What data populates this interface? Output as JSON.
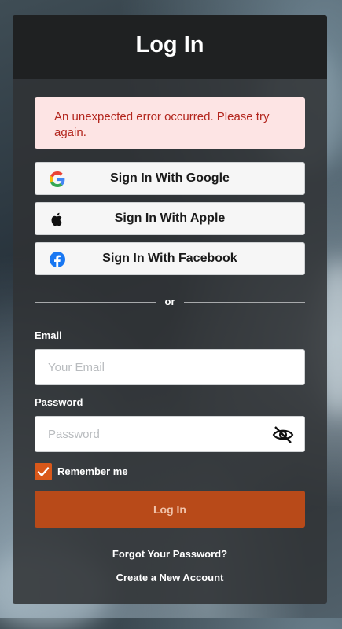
{
  "header": {
    "title": "Log In"
  },
  "alert": {
    "message": "An unexpected error occurred. Please try again."
  },
  "social": {
    "google": {
      "label": "Sign In With Google",
      "icon": "google-icon"
    },
    "apple": {
      "label": "Sign In With Apple",
      "icon": "apple-icon"
    },
    "facebook": {
      "label": "Sign In With Facebook",
      "icon": "facebook-icon"
    }
  },
  "divider": {
    "text": "or"
  },
  "form": {
    "email": {
      "label": "Email",
      "placeholder": "Your Email",
      "value": ""
    },
    "password": {
      "label": "Password",
      "placeholder": "Password",
      "value": ""
    },
    "remember": {
      "label": "Remember me",
      "checked": true
    },
    "submit_label": "Log In"
  },
  "links": {
    "forgot_password": "Forgot Your Password?",
    "create_account": "Create a New Account"
  },
  "colors": {
    "accent": "#d9581a",
    "button": "#b84a19",
    "error_text": "#b3261e",
    "error_bg": "#fde4e4"
  }
}
